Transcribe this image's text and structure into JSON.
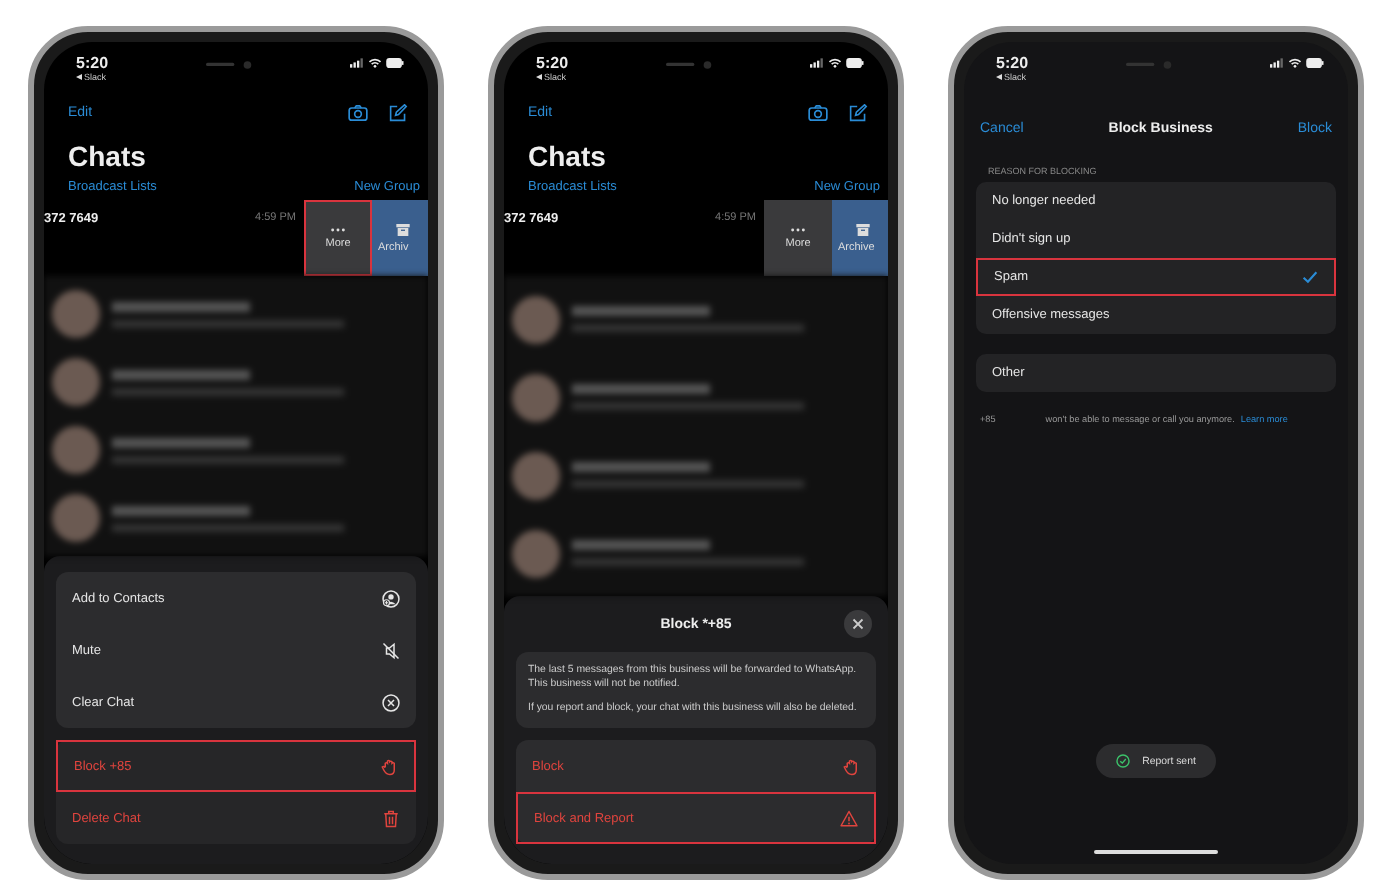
{
  "phones": [
    {
      "kind": "chats",
      "status": {
        "time": "5:20",
        "back": "Slack"
      },
      "nav": {
        "left": "Edit"
      },
      "title": "Chats",
      "links": [
        "Broadcast Lists",
        "New Group"
      ],
      "chat": {
        "name": "372 7649",
        "time": "4:59 PM",
        "actions": [
          {
            "kind": "more",
            "label": "More",
            "highlighted": true
          },
          {
            "kind": "archive",
            "label": "Archiv",
            "highlighted": false
          }
        ]
      },
      "sheet": {
        "kind": "menu",
        "groups": [
          [
            {
              "kind": "add-contact",
              "label": "Add to Contacts",
              "destructive": false,
              "highlighted": false
            },
            {
              "kind": "mute",
              "label": "Mute",
              "destructive": false,
              "highlighted": false
            },
            {
              "kind": "clear",
              "label": "Clear Chat",
              "destructive": false,
              "highlighted": false
            }
          ],
          [
            {
              "kind": "block",
              "label": "Block +85",
              "destructive": true,
              "highlighted": true
            },
            {
              "kind": "delete",
              "label": "Delete Chat",
              "destructive": true,
              "highlighted": false
            }
          ]
        ]
      }
    },
    {
      "kind": "chats",
      "status": {
        "time": "5:20",
        "back": "Slack"
      },
      "nav": {
        "left": "Edit"
      },
      "title": "Chats",
      "links": [
        "Broadcast Lists",
        "New Group"
      ],
      "chat": {
        "name": "372 7649",
        "time": "4:59 PM",
        "actions": [
          {
            "kind": "more",
            "label": "More",
            "highlighted": false
          },
          {
            "kind": "archive",
            "label": "Archive",
            "highlighted": false
          }
        ]
      },
      "sheet": {
        "kind": "dialog",
        "title": "Block *+85",
        "info": [
          "The last 5 messages from this business will be forwarded to WhatsApp. This business will not be notified.",
          "If you report and block, your chat with this business will also be deleted."
        ],
        "groups": [
          [
            {
              "kind": "block",
              "label": "Block",
              "destructive": true,
              "highlighted": false
            },
            {
              "kind": "report",
              "label": "Block and Report",
              "destructive": true,
              "highlighted": true
            }
          ]
        ]
      }
    },
    {
      "kind": "block-form",
      "status": {
        "time": "5:20",
        "back": "Slack"
      },
      "nav": {
        "cancel": "Cancel",
        "title": "Block Business",
        "action": "Block"
      },
      "section": "REASON FOR BLOCKING",
      "options": [
        {
          "label": "No longer needed",
          "selected": false,
          "highlighted": false
        },
        {
          "label": "Didn't sign up",
          "selected": false,
          "highlighted": false
        },
        {
          "label": "Spam",
          "selected": true,
          "highlighted": true
        },
        {
          "label": "Offensive messages",
          "selected": false,
          "highlighted": false
        }
      ],
      "other": {
        "label": "Other"
      },
      "footer": {
        "number": "+85",
        "text": "won't be able to message or call you anymore.",
        "link": "Learn more"
      },
      "toast": "Report sent"
    }
  ]
}
